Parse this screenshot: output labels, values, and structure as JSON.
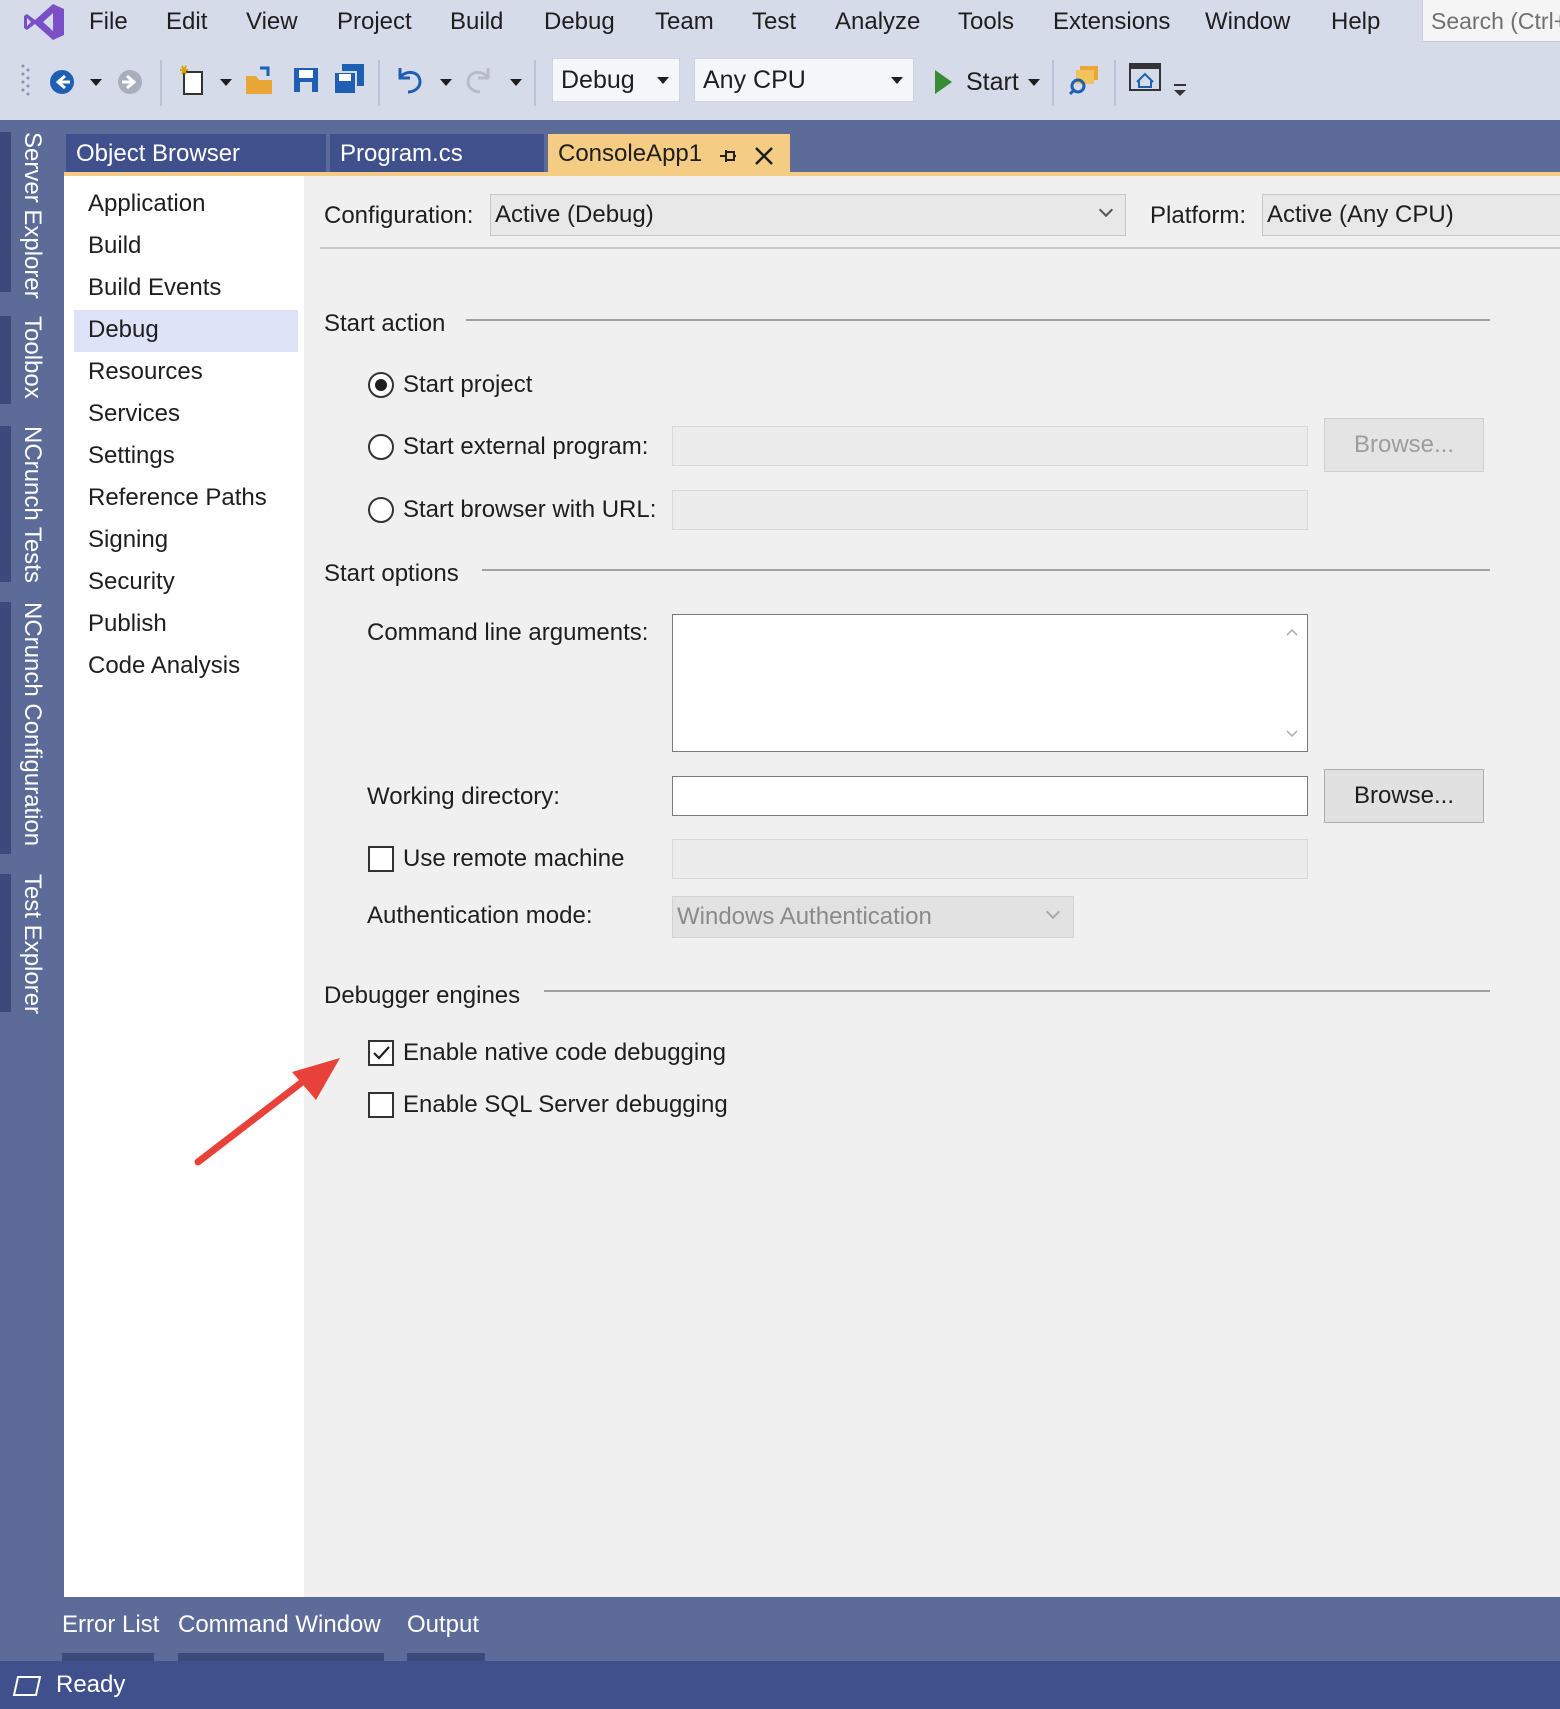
{
  "menu": {
    "items": [
      "File",
      "Edit",
      "View",
      "Project",
      "Build",
      "Debug",
      "Team",
      "Test",
      "Analyze",
      "Tools",
      "Extensions",
      "Window",
      "Help"
    ],
    "search_placeholder": "Search (Ctrl+Q)"
  },
  "toolbar": {
    "configuration": "Debug",
    "platform": "Any CPU",
    "start_label": "Start"
  },
  "side_tabs": [
    "Server Explorer",
    "Toolbox",
    "NCrunch Tests",
    "NCrunch Configuration",
    "Test Explorer"
  ],
  "doc_tabs": [
    {
      "label": "Object Browser",
      "active": false
    },
    {
      "label": "Program.cs",
      "active": false
    },
    {
      "label": "ConsoleApp1",
      "active": true
    }
  ],
  "prop_nav": {
    "items": [
      "Application",
      "Build",
      "Build Events",
      "Debug",
      "Resources",
      "Services",
      "Settings",
      "Reference Paths",
      "Signing",
      "Security",
      "Publish",
      "Code Analysis"
    ],
    "selected": "Debug"
  },
  "config_row": {
    "configuration_label": "Configuration:",
    "configuration_value": "Active (Debug)",
    "platform_label": "Platform:",
    "platform_value": "Active (Any CPU)"
  },
  "start_action": {
    "heading": "Start action",
    "start_project": "Start project",
    "start_external": "Start external program:",
    "start_browser": "Start browser with URL:",
    "browse_label": "Browse...",
    "selected": "start_project"
  },
  "start_options": {
    "heading": "Start options",
    "cmd_args_label": "Command line arguments:",
    "cmd_args_value": "",
    "working_dir_label": "Working directory:",
    "working_dir_value": "",
    "browse_label": "Browse...",
    "remote_label": "Use remote machine",
    "remote_checked": false,
    "auth_label": "Authentication mode:",
    "auth_value": "Windows Authentication"
  },
  "debugger_engines": {
    "heading": "Debugger engines",
    "native_label": "Enable native code debugging",
    "native_checked": true,
    "sql_label": "Enable SQL Server debugging",
    "sql_checked": false
  },
  "bottom_tabs": [
    "Error List",
    "Command Window",
    "Output"
  ],
  "status": {
    "text": "Ready"
  },
  "colors": {
    "accent_tab": "#f5cc84",
    "frame": "#5d6b99",
    "status_bar": "#40508d",
    "arrow": "#e8413a"
  }
}
